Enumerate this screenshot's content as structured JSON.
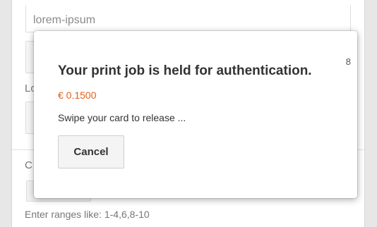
{
  "background_form": {
    "top_input_value": "lorem-ipsum",
    "label_1": "Lo",
    "label_2": "C",
    "hint": "Enter ranges like: 1-4,6,8-10"
  },
  "modal": {
    "counter": "8",
    "title": "Your print job is held for authentication.",
    "price": "€ 0.1500",
    "message": "Swipe your card to release ...",
    "cancel_label": "Cancel"
  },
  "colors": {
    "price": "#e25f16",
    "text": "#333333",
    "muted": "#777777"
  }
}
